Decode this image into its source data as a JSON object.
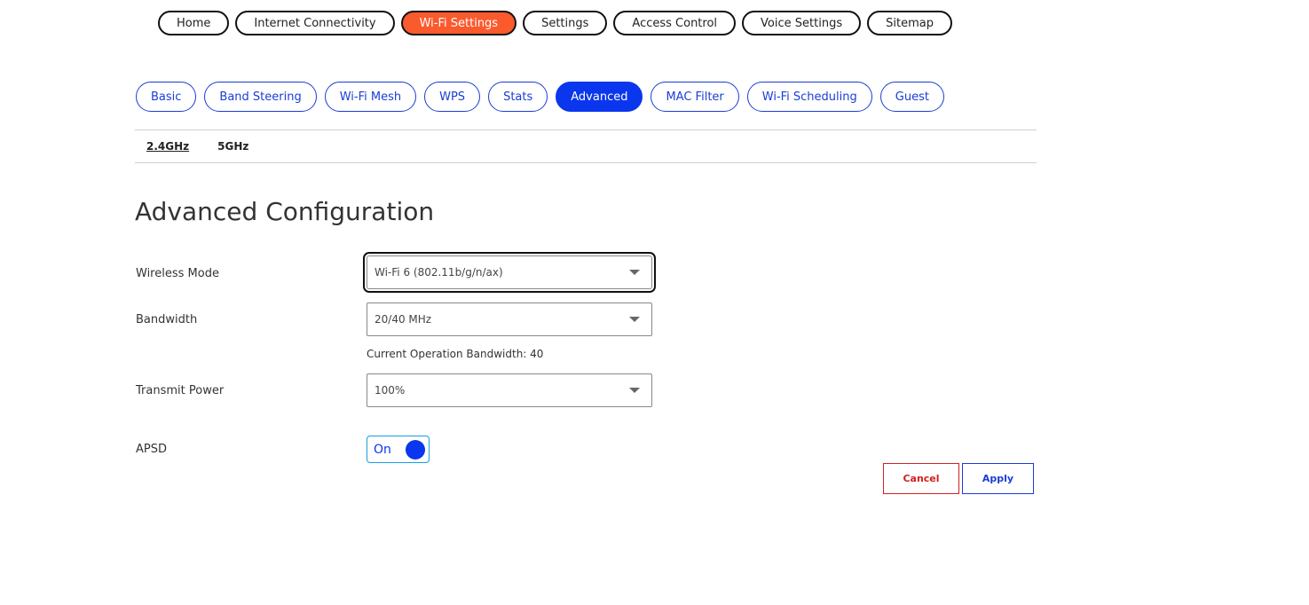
{
  "top_nav": [
    {
      "label": "Home",
      "active": false
    },
    {
      "label": "Internet Connectivity",
      "active": false
    },
    {
      "label": "Wi-Fi Settings",
      "active": true
    },
    {
      "label": "Settings",
      "active": false
    },
    {
      "label": "Access Control",
      "active": false
    },
    {
      "label": "Voice Settings",
      "active": false
    },
    {
      "label": "Sitemap",
      "active": false
    }
  ],
  "sub_nav": [
    {
      "label": "Basic",
      "active": false
    },
    {
      "label": "Band Steering",
      "active": false
    },
    {
      "label": "Wi-Fi Mesh",
      "active": false
    },
    {
      "label": "WPS",
      "active": false
    },
    {
      "label": "Stats",
      "active": false
    },
    {
      "label": "Advanced",
      "active": true
    },
    {
      "label": "MAC Filter",
      "active": false
    },
    {
      "label": "Wi-Fi Scheduling",
      "active": false
    },
    {
      "label": "Guest",
      "active": false
    }
  ],
  "band_tabs": [
    {
      "label": "2.4GHz",
      "active": true
    },
    {
      "label": "5GHz",
      "active": false
    }
  ],
  "page_title": "Advanced Configuration",
  "form": {
    "wireless_mode": {
      "label": "Wireless Mode",
      "value": "Wi-Fi 6 (802.11b/g/n/ax)"
    },
    "bandwidth": {
      "label": "Bandwidth",
      "value": "20/40 MHz"
    },
    "current_bandwidth_text": "Current Operation Bandwidth: 40",
    "transmit_power": {
      "label": "Transmit Power",
      "value": "100%"
    },
    "apsd": {
      "label": "APSD",
      "state_label": "On"
    }
  },
  "buttons": {
    "cancel": "Cancel",
    "apply": "Apply"
  },
  "colors": {
    "top_nav_active": "#fb5a2d",
    "sub_nav_active": "#0a36ee",
    "accent_blue": "#1a3dd6",
    "cancel_red": "#d32020"
  }
}
